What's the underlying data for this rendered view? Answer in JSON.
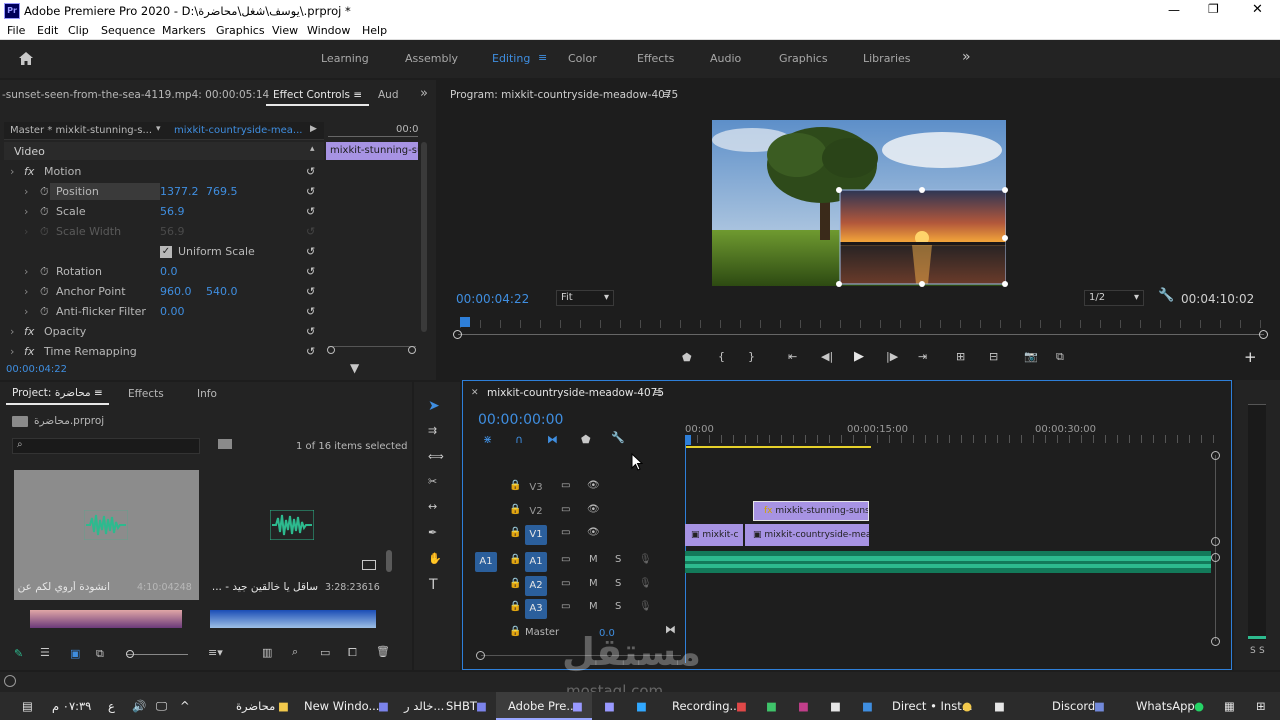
{
  "title_bar": {
    "app_label": "Adobe Premiere Pro 2020 - D:\\يوسف\\شغل\\محاضرة\\.prproj *",
    "minimize": "—",
    "maximize": "❐",
    "close": "✕"
  },
  "menu": [
    "File",
    "Edit",
    "Clip",
    "Sequence",
    "Markers",
    "Graphics",
    "View",
    "Window",
    "Help"
  ],
  "workspaces": {
    "items": [
      "Learning",
      "Assembly",
      "Editing",
      "Color",
      "Effects",
      "Audio",
      "Graphics",
      "Libraries"
    ],
    "active": "Editing",
    "more": "»"
  },
  "source_panel": {
    "clip_label": "-sunset-seen-from-the-sea-4119.mp4: 00:00:05:14",
    "tabs": [
      "Effect Controls",
      "Aud"
    ],
    "master": "Master * mixkit-stunning-s...",
    "sequence_link": "mixkit-countryside-mea...",
    "timecode_right": "00:0",
    "clip_bar": "mixkit-stunning-sun",
    "section_video": "Video",
    "properties": [
      {
        "name": "Motion",
        "fx": true,
        "value1": "",
        "value2": ""
      },
      {
        "name": "Position",
        "value1": "1377.2",
        "value2": "769.5"
      },
      {
        "name": "Scale",
        "value1": "56.9",
        "value2": ""
      },
      {
        "name": "Scale Width",
        "value1": "56.9",
        "value2": "",
        "disabled": true
      },
      {
        "name": "Uniform Scale",
        "checkbox": true
      },
      {
        "name": "Rotation",
        "value1": "0.0",
        "value2": ""
      },
      {
        "name": "Anchor Point",
        "value1": "960.0",
        "value2": "540.0"
      },
      {
        "name": "Anti-flicker Filter",
        "value1": "0.00",
        "value2": ""
      },
      {
        "name": "Opacity",
        "fx": true
      },
      {
        "name": "Time Remapping",
        "fx": true
      }
    ],
    "timecode": "00:00:04:22"
  },
  "program": {
    "title": "Program: mixkit-countryside-meadow-4075",
    "timecode": "00:00:04:22",
    "fit": "Fit",
    "resolution": "1/2",
    "duration": "00:04:10:02"
  },
  "project": {
    "tab": "Project: محاضرة",
    "tabs_other": [
      "Effects",
      "Info"
    ],
    "file": "محاضرة.prproj",
    "selection": "1 of 16 items selected",
    "items": [
      {
        "name": "انشودة أروي لكم عن ق",
        "duration": "4:10:04248"
      },
      {
        "name": "ساقل يا خالقين جيد - ...",
        "duration": "3:28:23616"
      }
    ]
  },
  "timeline": {
    "sequence": "mixkit-countryside-meadow-4075",
    "timecode": "00:00:00:00",
    "ruler": [
      "00:00",
      "00:00:15:00",
      "00:00:30:00"
    ],
    "tracks": [
      {
        "id": "V3",
        "type": "video"
      },
      {
        "id": "V2",
        "type": "video"
      },
      {
        "id": "V1",
        "type": "video"
      },
      {
        "id": "A1",
        "type": "audio"
      },
      {
        "id": "A2",
        "type": "audio"
      },
      {
        "id": "A3",
        "type": "audio"
      }
    ],
    "master": "Master",
    "master_value": "0.0",
    "clips": [
      {
        "track": "V2",
        "label": "mixkit-stunning-sunse"
      },
      {
        "track": "V1",
        "label": "mixkit-c"
      },
      {
        "track": "V1",
        "label": "mixkit-countryside-mead"
      }
    ],
    "meter_labels": [
      "S",
      "S"
    ]
  },
  "taskbar": {
    "time": "٠٧:٣٩ م",
    "lang": "ع",
    "items": [
      "محاضرة",
      "New Windo...",
      "خالد ر...",
      "SHBT",
      "Adobe Pre...",
      "Recording...",
      "Direct • Inst...",
      "Discord",
      "WhatsApp"
    ],
    "watermark": "مستقل",
    "watermark_sub": "mostaql.com"
  },
  "colors": {
    "accent": "#3f8ee0",
    "clip_video": "#a793e3",
    "clip_audio": "#2dba8e",
    "playhead": "#2e7fd9",
    "panel": "#232323"
  }
}
